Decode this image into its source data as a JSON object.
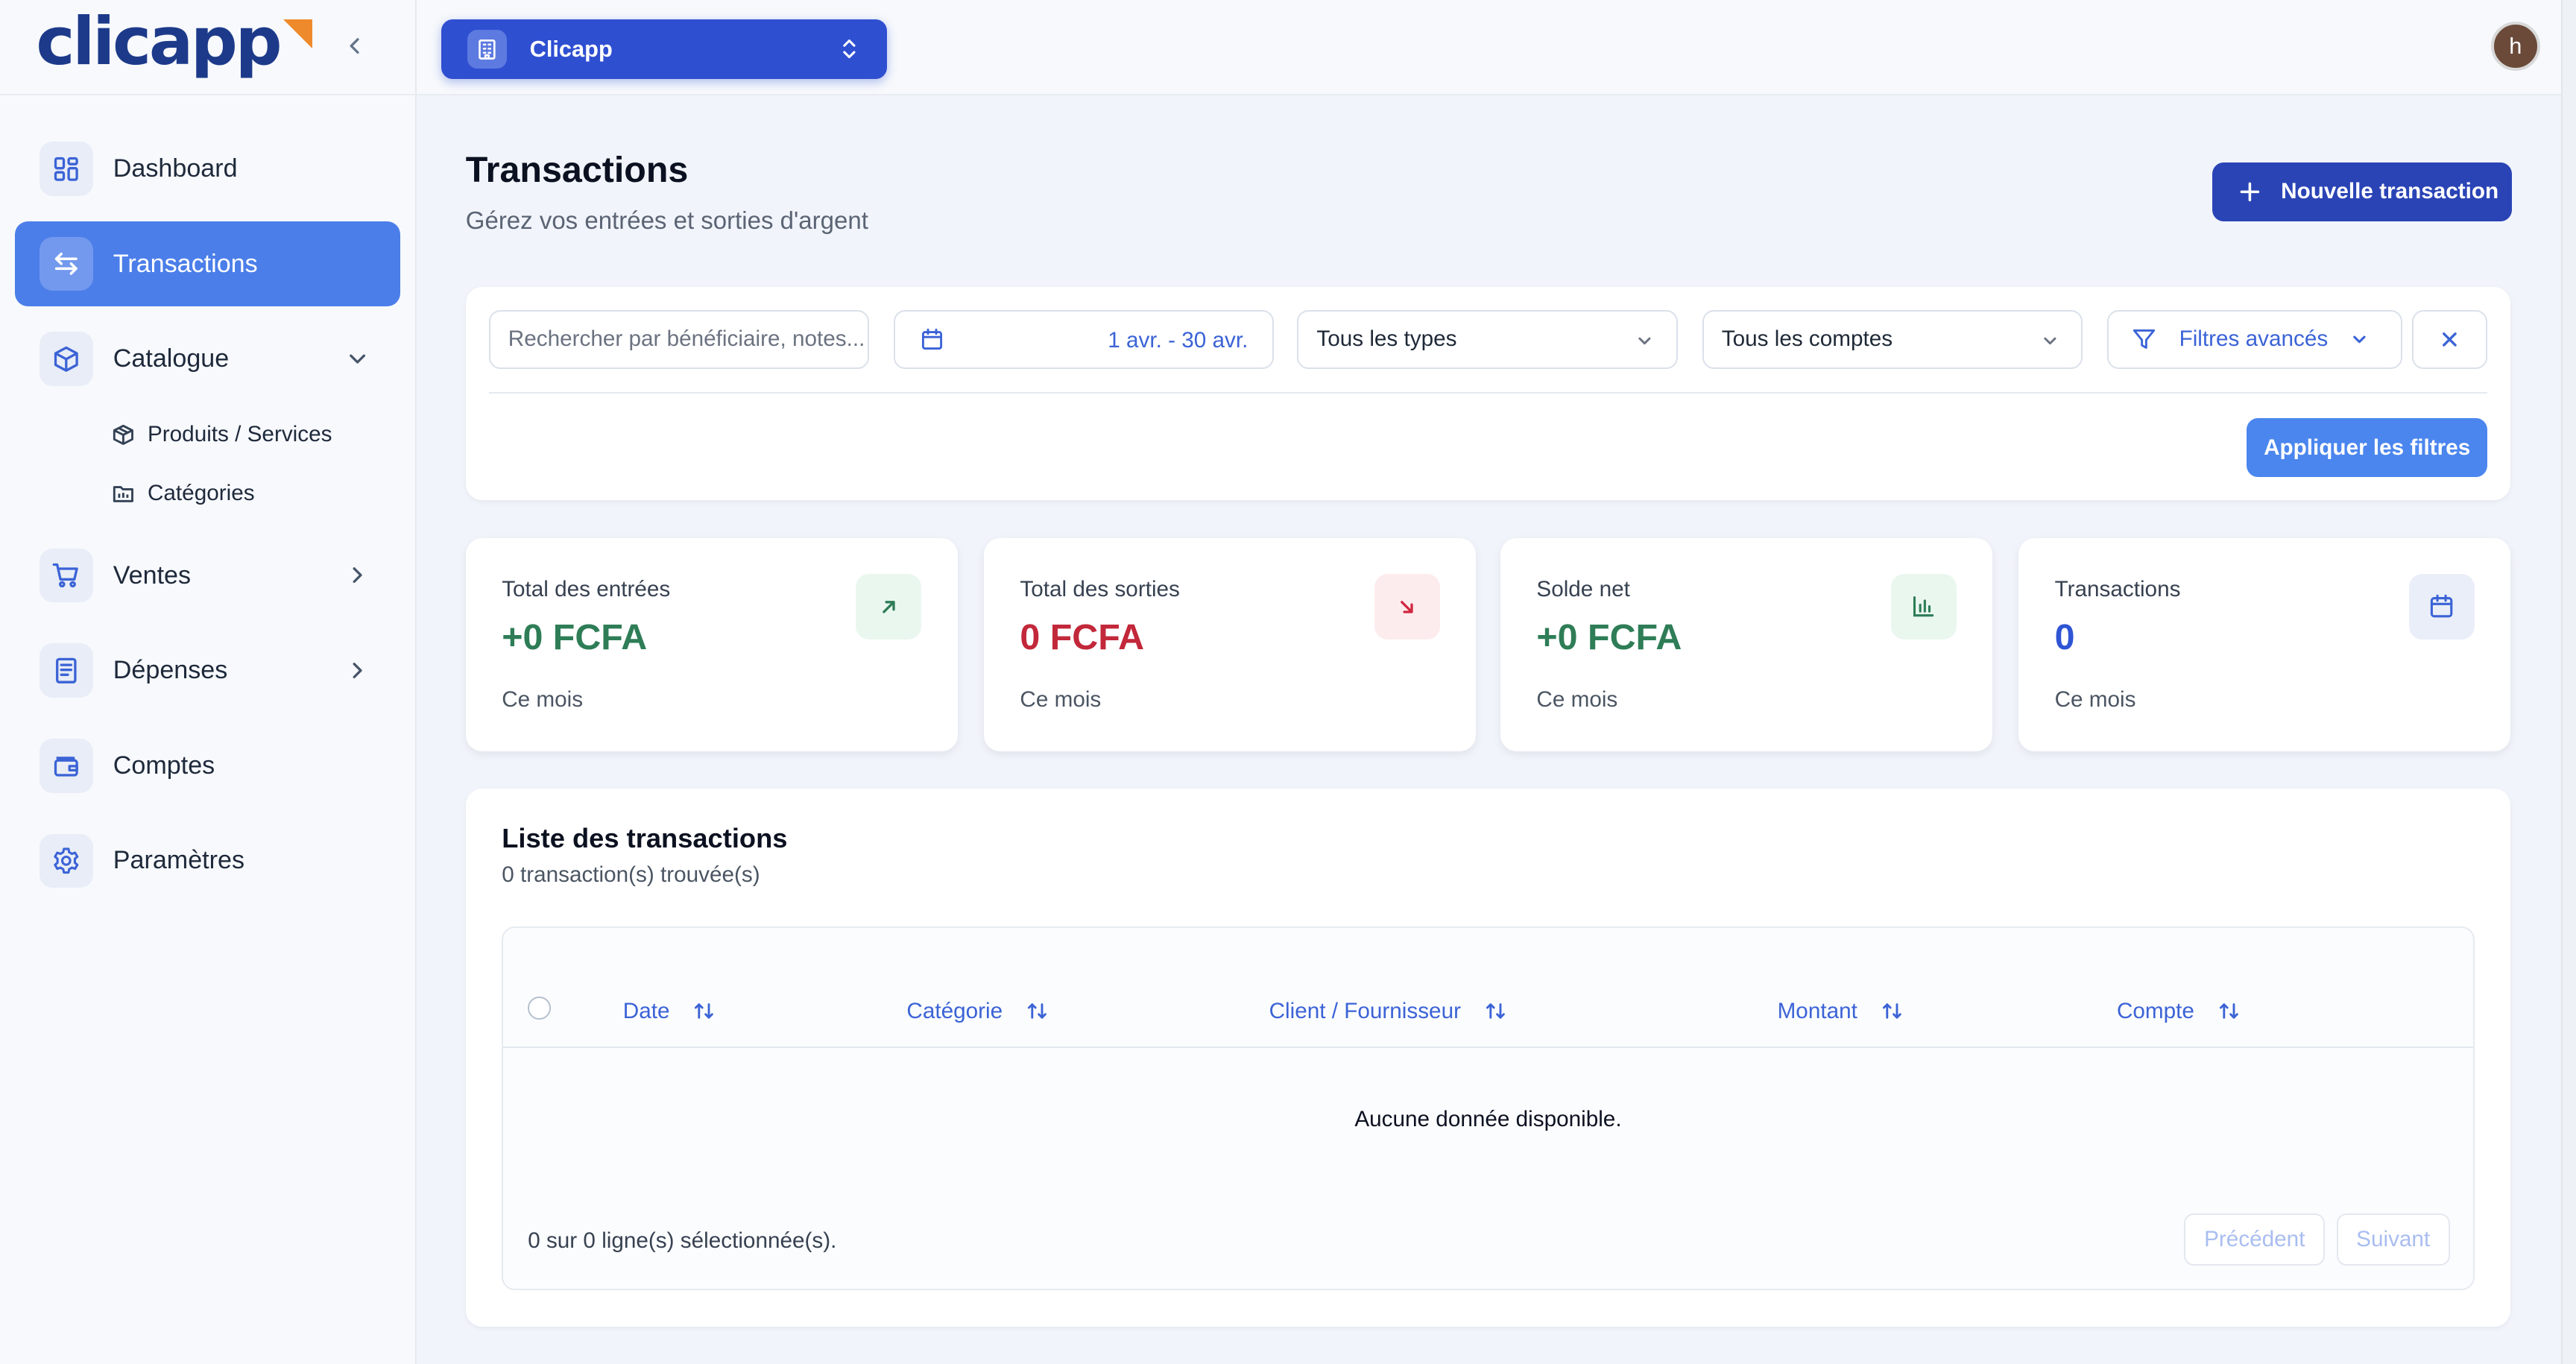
{
  "app": {
    "brand": "clicapp",
    "org_name": "Clicapp",
    "avatar_initial": "h"
  },
  "sidebar": {
    "items": [
      {
        "label": "Dashboard",
        "icon": "dashboard-icon"
      },
      {
        "label": "Transactions",
        "icon": "arrows-exchange-icon",
        "active": true
      },
      {
        "label": "Catalogue",
        "icon": "package-icon",
        "expanded": true
      },
      {
        "label": "Ventes",
        "icon": "cart-icon"
      },
      {
        "label": "Dépenses",
        "icon": "receipt-icon"
      },
      {
        "label": "Comptes",
        "icon": "wallet-icon"
      },
      {
        "label": "Paramètres",
        "icon": "gear-icon"
      }
    ],
    "catalogue_sub": [
      {
        "label": "Produits / Services",
        "icon": "box-icon"
      },
      {
        "label": "Catégories",
        "icon": "folder-icon"
      }
    ]
  },
  "header": {
    "title": "Transactions",
    "subtitle": "Gérez vos entrées et sorties d'argent",
    "new_button": "Nouvelle transaction"
  },
  "filters": {
    "search_placeholder": "Rechercher par bénéficiaire, notes...",
    "date_range": "1 avr. - 30 avr.",
    "type_value": "Tous les types",
    "account_value": "Tous les comptes",
    "advanced_label": "Filtres avancés",
    "apply_label": "Appliquer les filtres"
  },
  "stats": [
    {
      "label": "Total des entrées",
      "value": "+0 FCFA",
      "footer": "Ce mois",
      "color": "#2e7d57",
      "icon": "arrow-up-right-icon",
      "icon_bg": "#eaf7ef",
      "icon_color": "#2e7d57"
    },
    {
      "label": "Total des sorties",
      "value": "0 FCFA",
      "footer": "Ce mois",
      "color": "#c2283a",
      "icon": "arrow-down-right-icon",
      "icon_bg": "#fdecee",
      "icon_color": "#d0283f"
    },
    {
      "label": "Solde net",
      "value": "+0 FCFA",
      "footer": "Ce mois",
      "color": "#2e7d57",
      "icon": "bar-chart-icon",
      "icon_bg": "#eaf7ef",
      "icon_color": "#2e7d57"
    },
    {
      "label": "Transactions",
      "value": "0",
      "footer": "Ce mois",
      "color": "#2f55d4",
      "icon": "calendar-icon",
      "icon_bg": "#e9eef9",
      "icon_color": "#3b63d6"
    }
  ],
  "list": {
    "title": "Liste des transactions",
    "count_text": "0 transaction(s) trouvée(s)",
    "columns": [
      "Date",
      "Catégorie",
      "Client / Fournisseur",
      "Montant",
      "Compte"
    ],
    "empty_text": "Aucune donnée disponible.",
    "selection_text": "0 sur 0 ligne(s) sélectionnée(s).",
    "prev_label": "Précédent",
    "next_label": "Suivant"
  }
}
